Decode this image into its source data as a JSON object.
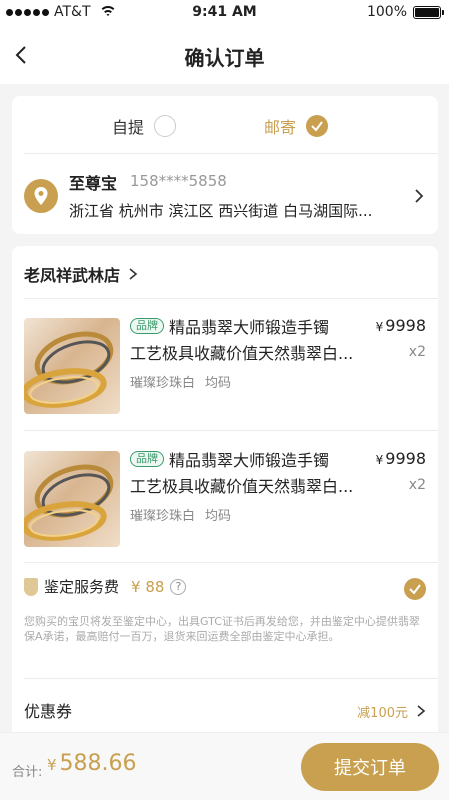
{
  "status_bar": {
    "carrier": "AT&T",
    "time": "9:41 AM",
    "battery": "100%"
  },
  "nav": {
    "title": "确认订单"
  },
  "delivery": {
    "pickup_label": "自提",
    "mail_label": "邮寄",
    "selected": "mail",
    "accent_color": "#c8a050"
  },
  "address": {
    "name": "至尊宝",
    "phone": "158****5858",
    "line": "浙江省 杭州市 滨江区 西兴街道 白马湖国际..."
  },
  "shop": {
    "name": "老凤祥武林店"
  },
  "products": [
    {
      "badge": "品牌",
      "title": "精品翡翠大师锻造手镯",
      "title_line2": "工艺极具收藏价值天然翡翠白...",
      "spec_color": "璀璨珍珠白",
      "spec_size": "均码",
      "currency": "¥",
      "price": "9998",
      "qty": "x2"
    },
    {
      "badge": "品牌",
      "title": "精品翡翠大师锻造手镯",
      "title_line2": "工艺极具收藏价值天然翡翠白...",
      "spec_color": "璀璨珍珠白",
      "spec_size": "均码",
      "currency": "¥",
      "price": "9998",
      "qty": "x2"
    }
  ],
  "service": {
    "label": "鉴定服务费",
    "price": "¥ 88",
    "help_glyph": "?",
    "description": "您购买的宝贝将发至鉴定中心，出具GTC证书后再发给您，并由鉴定中心提供翡翠保A承诺，最高赔付一百万，退货来回运费全部由鉴定中心承担。"
  },
  "coupon": {
    "label": "优惠券",
    "value": "减100元"
  },
  "footer": {
    "total_label": "合计:",
    "currency": "¥",
    "total": "588.66",
    "submit_label": "提交订单"
  }
}
